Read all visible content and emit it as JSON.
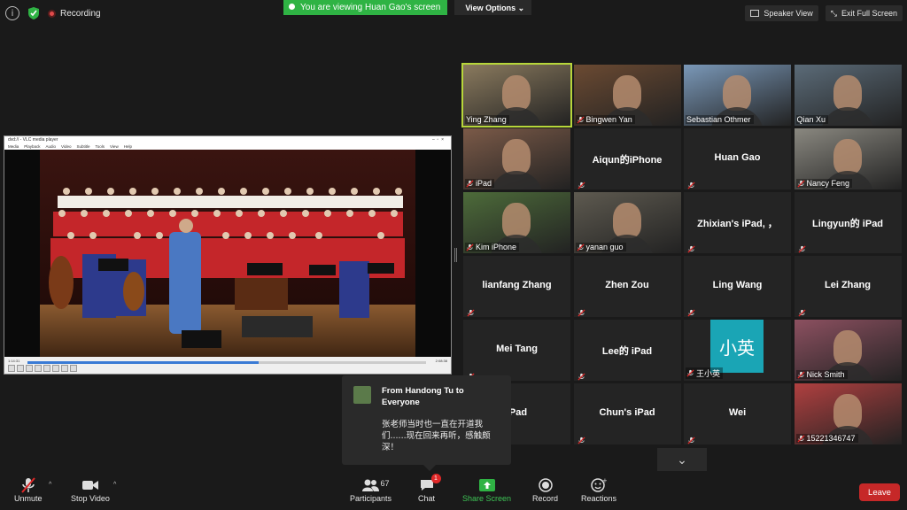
{
  "topbar": {
    "recording_label": "Recording",
    "viewing_text": "You are viewing Huan Gao's screen",
    "view_options_label": "View Options",
    "speaker_view_label": "Speaker View",
    "exit_fullscreen_label": "Exit Full Screen"
  },
  "vlc": {
    "window_title": "dvd://  - VLC media player",
    "menu": [
      "Media",
      "Playback",
      "Audio",
      "Video",
      "Subtitle",
      "Tools",
      "View",
      "Help"
    ],
    "elapsed": "1:14:31",
    "remaining": "2:08:38",
    "progress": 0.58
  },
  "participants": [
    {
      "name": "Ying Zhang",
      "video": true,
      "active": true,
      "muted": false,
      "bg": "#8a7a5e"
    },
    {
      "name": "Bingwen Yan",
      "video": true,
      "muted": true,
      "bg": "#6b4a32"
    },
    {
      "name": "Sebastian Othmer",
      "video": true,
      "muted": false,
      "bg": "#7a98b8"
    },
    {
      "name": "Qian Xu",
      "video": true,
      "muted": false,
      "bg": "#5b6b78"
    },
    {
      "name": "iPad",
      "video": true,
      "muted": true,
      "bg": "#7b5a48"
    },
    {
      "name": "Aiqun的iPhone",
      "video": false,
      "muted": true
    },
    {
      "name": "Huan Gao",
      "video": false,
      "muted": true
    },
    {
      "name": "Nancy Feng",
      "video": true,
      "muted": true,
      "bg": "#8a8880"
    },
    {
      "name": "Kim iPhone",
      "video": true,
      "muted": true,
      "bg": "#4d6b3a"
    },
    {
      "name": "yanan guo",
      "video": true,
      "muted": true,
      "bg": "#5e5a50"
    },
    {
      "name": "Zhixian's iPad, ，",
      "video": false,
      "muted": true
    },
    {
      "name": "Lingyun的 iPad",
      "video": false,
      "muted": true
    },
    {
      "name": "lianfang Zhang",
      "video": false,
      "muted": true
    },
    {
      "name": "Zhen Zou",
      "video": false,
      "muted": true
    },
    {
      "name": "Ling Wang",
      "video": false,
      "muted": true
    },
    {
      "name": "Lei Zhang",
      "video": false,
      "muted": true
    },
    {
      "name": "Mei Tang",
      "video": false,
      "muted": true
    },
    {
      "name": "Lee的 iPad",
      "video": false,
      "muted": true
    },
    {
      "name": "王小英",
      "video": false,
      "avatar": "小英",
      "muted": true
    },
    {
      "name": "Nick Smith",
      "video": true,
      "muted": true,
      "bg": "#8c5060"
    },
    {
      "name": "iPad",
      "video": false,
      "muted": true
    },
    {
      "name": "Chun's iPad",
      "video": false,
      "muted": true
    },
    {
      "name": "Wei",
      "video": false,
      "muted": true
    },
    {
      "name": "15221346747",
      "video": true,
      "muted": true,
      "bg": "#b04040"
    }
  ],
  "chat_popup": {
    "from": "From Handong Tu to Everyone",
    "message": "张老师当时也一直在开道我们......现在回来再听，感触颇深！"
  },
  "toolbar": {
    "unmute_label": "Unmute",
    "stop_video_label": "Stop Video",
    "participants_label": "Participants",
    "participants_count": "67",
    "chat_label": "Chat",
    "chat_badge": "1",
    "share_label": "Share Screen",
    "record_label": "Record",
    "reactions_label": "Reactions",
    "leave_label": "Leave"
  },
  "colors": {
    "share_green": "#2fb344",
    "active_speaker": "#b7d63a",
    "leave_red": "#c62828",
    "avatar_teal": "#1aa5b5"
  }
}
